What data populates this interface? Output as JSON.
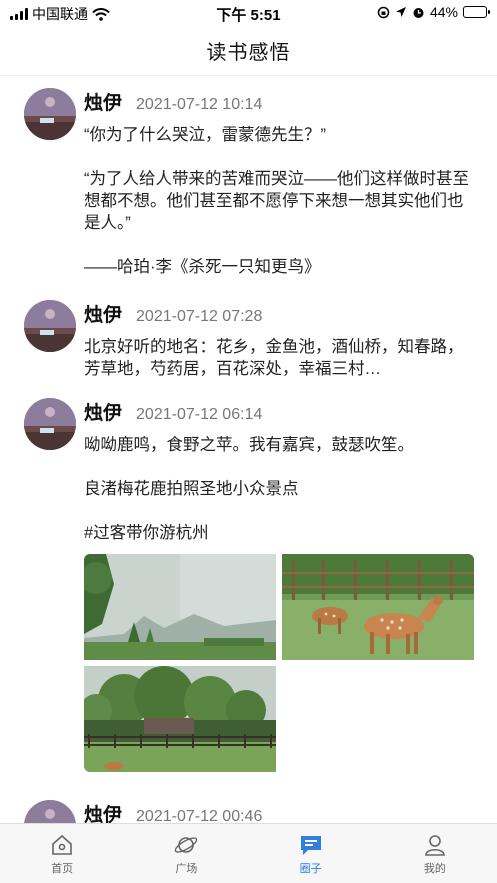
{
  "status_bar": {
    "carrier": "中国联通",
    "time": "下午 5:51",
    "battery": "44%",
    "battery_level": 0.44
  },
  "header": {
    "title": "读书感悟"
  },
  "posts": [
    {
      "author": "烛伊",
      "time": "2021-07-12 10:14",
      "paragraphs": [
        "“你为了什么哭泣，雷蒙德先生？”",
        "“为了人给人带来的苦难而哭泣——他们这样做时甚至想都不想。他们甚至都不愿停下来想一想其实他们也是人。”",
        "——哈珀·李《杀死一只知更鸟》"
      ]
    },
    {
      "author": "烛伊",
      "time": "2021-07-12 07:28",
      "paragraphs": [
        "北京好听的地名：花乡，金鱼池，酒仙桥，知春路，芳草地，芍药居，百花深处，幸福三村…"
      ]
    },
    {
      "author": "烛伊",
      "time": "2021-07-12 06:14",
      "paragraphs": [
        "呦呦鹿鸣，食野之苹。我有嘉宾，鼓瑟吹笙。",
        "良渚梅花鹿拍照圣地小众景点",
        "#过客带你游杭州"
      ],
      "photos": [
        "misty-trees-photo",
        "deer-photo",
        "farm-fence-photo"
      ]
    },
    {
      "author": "烛伊",
      "time": "2021-07-12 00:46"
    }
  ],
  "tab_bar": {
    "tabs": [
      {
        "label": "首页",
        "icon": "home-icon",
        "active": false
      },
      {
        "label": "广场",
        "icon": "planet-icon",
        "active": false
      },
      {
        "label": "圈子",
        "icon": "chat-icon",
        "active": true
      },
      {
        "label": "我的",
        "icon": "user-icon",
        "active": false
      }
    ]
  },
  "colors": {
    "accent": "#2f7fe0",
    "text": "#222222",
    "muted": "#777777"
  }
}
